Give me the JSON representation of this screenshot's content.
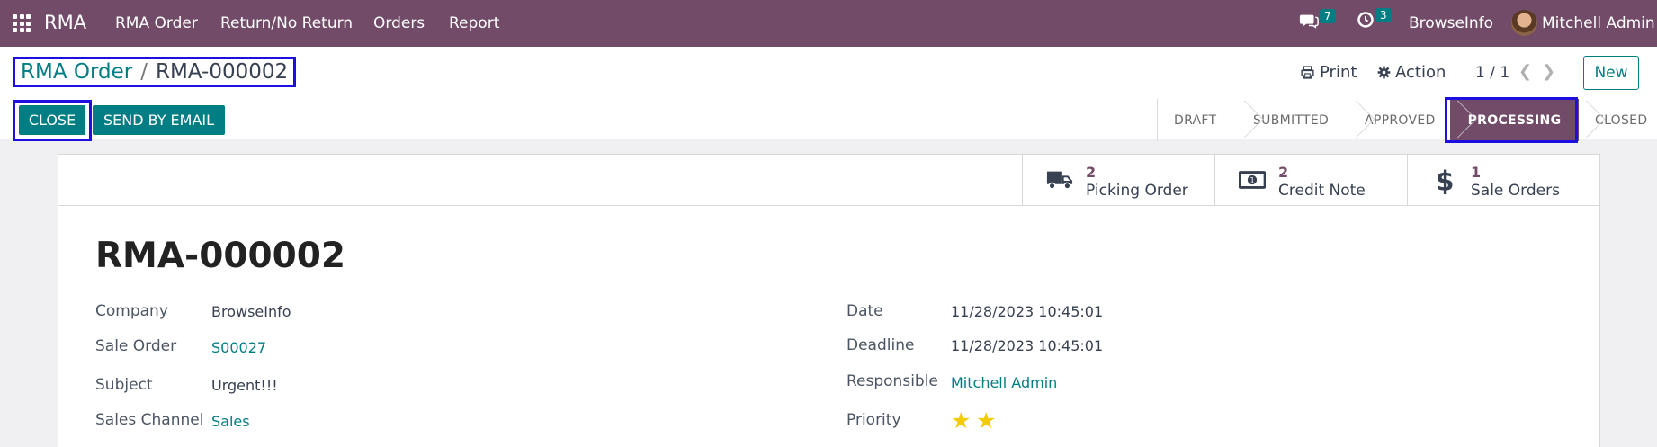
{
  "navbar": {
    "app_name": "RMA",
    "menu": [
      "RMA Order",
      "Return/No Return",
      "Orders",
      "Report"
    ],
    "messages_count": "7",
    "activities_count": "3",
    "company": "BrowseInfo",
    "user": "Mitchell Admin"
  },
  "breadcrumb": {
    "parent": "RMA Order",
    "separator": "/",
    "current": "RMA-000002"
  },
  "toolbar": {
    "print_label": "Print",
    "action_label": "Action",
    "pager": "1 / 1",
    "new_label": "New",
    "close_label": "CLOSE",
    "send_email_label": "SEND BY EMAIL"
  },
  "status": {
    "stages": [
      "DRAFT",
      "SUBMITTED",
      "APPROVED",
      "PROCESSING",
      "CLOSED"
    ],
    "current": "PROCESSING"
  },
  "smart_buttons": [
    {
      "count": "2",
      "label": "Picking Order",
      "icon": "truck-icon"
    },
    {
      "count": "2",
      "label": "Credit Note",
      "icon": "money-icon"
    },
    {
      "count": "1",
      "label": "Sale Orders",
      "icon": "dollar-icon"
    }
  ],
  "record": {
    "name": "RMA-000002",
    "fields_left": [
      {
        "label": "Company",
        "value": "BrowseInfo"
      },
      {
        "label": "Sale Order",
        "value": "S00027"
      },
      {
        "label": "Subject",
        "value": "Urgent!!!"
      },
      {
        "label": "Sales Channel",
        "value": "Sales"
      }
    ],
    "fields_right": [
      {
        "label": "Date",
        "value": "11/28/2023 10:45:01"
      },
      {
        "label": "Deadline",
        "value": "11/28/2023 10:45:01"
      },
      {
        "label": "Responsible",
        "value": "Mitchell Admin"
      },
      {
        "label": "Priority",
        "value": ""
      }
    ],
    "priority_stars": 2
  },
  "colors": {
    "brand": "#714b67",
    "accent": "#017e84",
    "highlight_border": "#1d0fe0",
    "star": "#f3cc00"
  }
}
